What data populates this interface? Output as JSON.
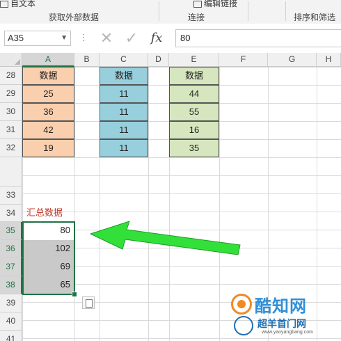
{
  "ribbon": {
    "top_items": [
      "自文本",
      "编辑链接"
    ],
    "groups": [
      "获取外部数据",
      "连接",
      "排序和筛选"
    ]
  },
  "formula_bar": {
    "name_box": "A35",
    "name_box_dropdown": "▼",
    "dots": "⋮",
    "cancel": "✕",
    "enter": "✓",
    "fx": "fx",
    "value": "80"
  },
  "columns": [
    "A",
    "B",
    "C",
    "D",
    "E",
    "F",
    "G",
    "H"
  ],
  "rows": [
    "28",
    "29",
    "30",
    "31",
    "32",
    "",
    "33",
    "34",
    "35",
    "36",
    "37",
    "38",
    "39",
    "40",
    "41"
  ],
  "selected": {
    "column": "A",
    "rows": [
      "35",
      "36",
      "37",
      "38"
    ]
  },
  "table_a": {
    "header": "数据",
    "values": [
      "25",
      "36",
      "42",
      "19"
    ],
    "color": "#f9cfae"
  },
  "table_c": {
    "header": "数据",
    "values": [
      "11",
      "11",
      "11",
      "11"
    ],
    "color": "#97cfdd"
  },
  "table_e": {
    "header": "数据",
    "values": [
      "44",
      "55",
      "16",
      "35"
    ],
    "color": "#d6e6be"
  },
  "summary": {
    "label": "汇总数据",
    "label_color": "#c0392b",
    "values": [
      "80",
      "102",
      "69",
      "65"
    ],
    "selected_fill": "#c9c9c9"
  },
  "arrow_color": "#33e03a",
  "watermark": {
    "title": "酷知网",
    "subtitle": "超羊首门网",
    "url": "www.yaoyangbang.com"
  }
}
